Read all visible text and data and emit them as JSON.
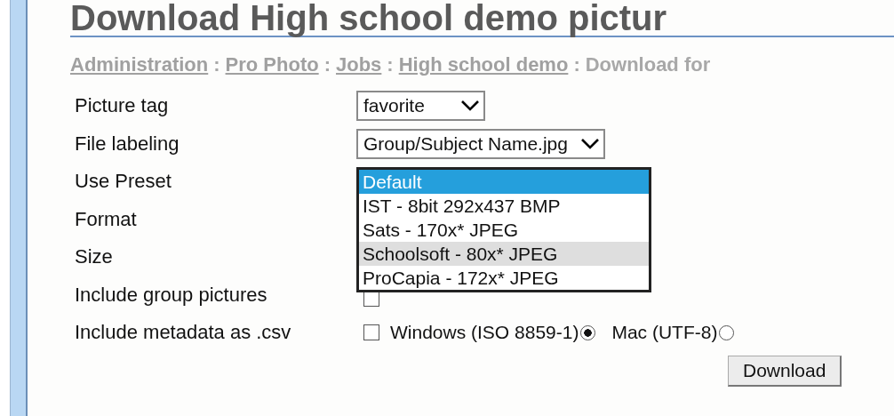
{
  "title": "Download High school demo pictur",
  "breadcrumb": [
    {
      "label": "Administration",
      "link": true
    },
    {
      "label": "Pro Photo",
      "link": true
    },
    {
      "label": "Jobs",
      "link": true
    },
    {
      "label": "High school demo",
      "link": true
    },
    {
      "label": "Download for",
      "link": false
    }
  ],
  "breadcrumb_separator": ":",
  "fields": [
    {
      "label": "Picture tag",
      "kind": "select",
      "value": "favorite"
    },
    {
      "label": "File labeling",
      "kind": "select",
      "value": "Group/Subject Name.jpg"
    },
    {
      "label": "Use Preset",
      "kind": "listbox",
      "options": [
        {
          "label": "Default",
          "selected": true,
          "hovered": false
        },
        {
          "label": "IST - 8bit 292x437 BMP",
          "selected": false,
          "hovered": false
        },
        {
          "label": "Sats - 170x* JPEG",
          "selected": false,
          "hovered": false
        },
        {
          "label": "Schoolsoft - 80x* JPEG",
          "selected": false,
          "hovered": true
        },
        {
          "label": "ProCapia - 172x* JPEG",
          "selected": false,
          "hovered": false
        }
      ]
    },
    {
      "label": "Format",
      "kind": "covered"
    },
    {
      "label": "Size",
      "kind": "covered"
    },
    {
      "label": "Include group pictures",
      "kind": "checkbox",
      "checked": false
    },
    {
      "label": "Include metadata as .csv",
      "kind": "metadata",
      "checked": false,
      "options": [
        {
          "label": "Windows (ISO 8859-1)",
          "selected": true
        },
        {
          "label": "Mac (UTF-8)",
          "selected": false
        }
      ]
    }
  ],
  "download_button": "Download"
}
